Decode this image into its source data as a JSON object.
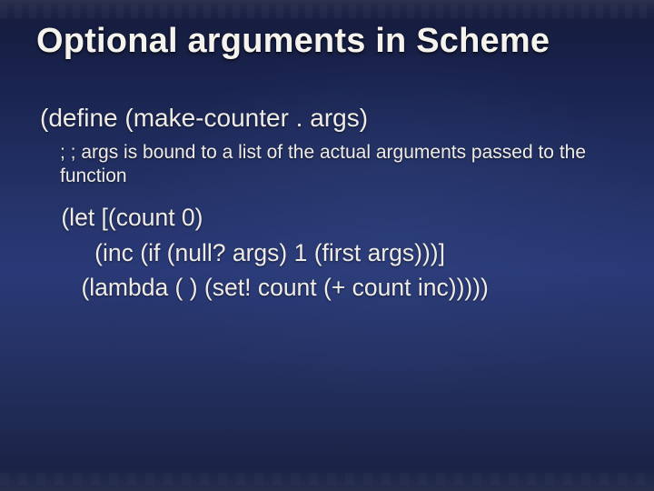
{
  "title": "Optional arguments in Scheme",
  "define_line": "(define (make-counter . args)",
  "comment": "; ; args is bound to a list of the actual arguments passed to the function",
  "code": {
    "l1": " (let [(count 0)",
    "l2": "      (inc (if (null? args) 1 (first args)))]",
    "l3": "    (lambda ( ) (set! count (+ count inc)))))"
  }
}
